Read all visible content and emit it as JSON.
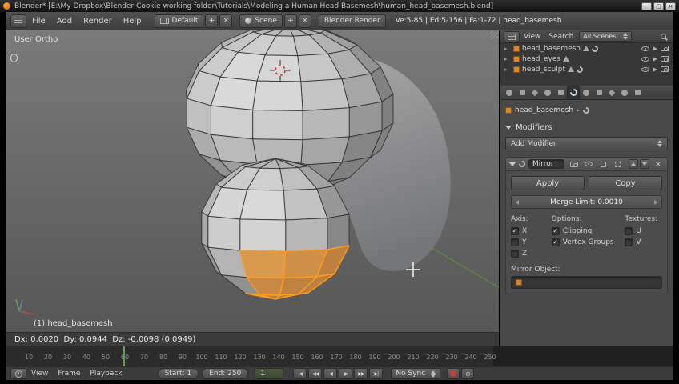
{
  "icons": {
    "window_minimize": "─",
    "window_maximize": "□",
    "window_close": "×",
    "collapse_down": "▼",
    "check": "✓",
    "close": "×",
    "plus": "+",
    "disclosure": "▸",
    "crumb_sep": "▸",
    "jump_start": "|◀",
    "prev_key": "◀◀",
    "play_reverse": "◀",
    "play": "▶",
    "next_key": "▶▶",
    "jump_end": "▶|"
  },
  "window": {
    "title": "Blender* [E:\\My Dropbox\\Blender Cookie working folder\\Tutorials\\Modeling a Human Head Basemesh\\human_head_basemesh.blend]"
  },
  "info_bar": {
    "menu_file": "File",
    "menu_add": "Add",
    "menu_render": "Render",
    "menu_help": "Help",
    "layout_value": "Default",
    "scene_value": "Scene",
    "engine_value": "Blender Render",
    "stats": "Ve:5-85 | Ed:5-156 | Fa:1-72 | head_basemesh"
  },
  "viewport": {
    "view_label": "User Ortho",
    "object_info": "(1) head_basemesh",
    "transform_status": "Dx: 0.0020  Dy: 0.0944  Dz: -0.0098 (0.0949)"
  },
  "outliner": {
    "menu_view": "View",
    "menu_search": "Search",
    "display_mode": "All Scenes",
    "items": [
      {
        "label": "head_basemesh"
      },
      {
        "label": "head_eyes"
      },
      {
        "label": "head_sculpt"
      }
    ]
  },
  "properties": {
    "tabs": [
      "render",
      "scene",
      "world",
      "object",
      "constraints",
      "modifiers",
      "object-data",
      "material",
      "texture",
      "particles",
      "physics"
    ],
    "active_tab": "modifiers",
    "breadcrumb": "head_basemesh",
    "modifiers_panel_label": "Modifiers",
    "add_modifier_label": "Add Modifier",
    "modifier": {
      "name": "Mirror",
      "apply_label": "Apply",
      "copy_label": "Copy",
      "merge_limit": "Merge Limit: 0.0010",
      "axis_label": "Axis:",
      "options_label": "Options:",
      "textures_label": "Textures:",
      "axis_x": {
        "label": "X",
        "checked": true
      },
      "axis_y": {
        "label": "Y",
        "checked": false
      },
      "axis_z": {
        "label": "Z",
        "checked": false
      },
      "clipping": {
        "label": "Clipping",
        "checked": true
      },
      "vertex_groups": {
        "label": "Vertex Groups",
        "checked": true
      },
      "tex_u": {
        "label": "U",
        "checked": false
      },
      "tex_v": {
        "label": "V",
        "checked": false
      },
      "mirror_object_label": "Mirror Object:"
    }
  },
  "timeline": {
    "ticks": [
      "10",
      "20",
      "30",
      "40",
      "50",
      "60",
      "70",
      "80",
      "90",
      "100",
      "110",
      "120",
      "130",
      "140",
      "150",
      "160",
      "170",
      "180",
      "190",
      "200",
      "210",
      "220",
      "230",
      "240",
      "250"
    ],
    "menu_view": "View",
    "menu_frame": "Frame",
    "menu_playback": "Playback",
    "start_field": "Start: 1",
    "end_field": "End: 250",
    "current_frame": "1",
    "sync_mode": "No Sync"
  }
}
